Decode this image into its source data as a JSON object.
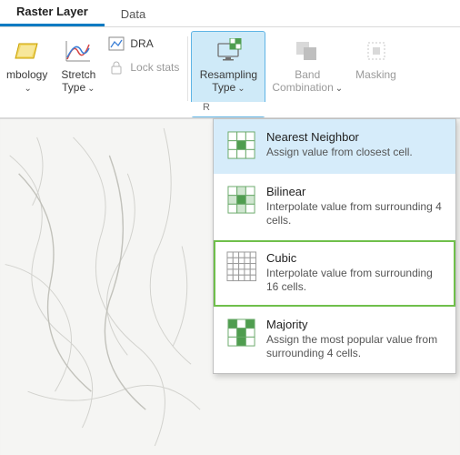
{
  "tabs": {
    "raster_layer": "Raster Layer",
    "data": "Data"
  },
  "ribbon": {
    "symbology": "mbology",
    "stretch_type_line1": "Stretch",
    "stretch_type_line2": "Type",
    "dra": "DRA",
    "lock_stats": "Lock stats",
    "resampling_line1": "Resampling",
    "resampling_line2": "Type",
    "band_combo_line1": "Band",
    "band_combo_line2": "Combination",
    "masking": "Masking",
    "group_r": "R"
  },
  "dropdown": {
    "items": [
      {
        "title": "Nearest Neighbor",
        "desc": "Assign value from closest cell.",
        "icon": "nearest"
      },
      {
        "title": "Bilinear",
        "desc": "Interpolate value from surrounding 4 cells.",
        "icon": "bilinear"
      },
      {
        "title": "Cubic",
        "desc": "Interpolate value from surrounding 16 cells.",
        "icon": "cubic"
      },
      {
        "title": "Majority",
        "desc": "Assign the most popular value from surrounding 4 cells.",
        "icon": "majority"
      }
    ]
  },
  "colors": {
    "accent": "#007ac2",
    "hover_bg": "#d6ecfa",
    "highlight_border": "#6fbf4b",
    "icon_green": "#4f9d4f"
  }
}
